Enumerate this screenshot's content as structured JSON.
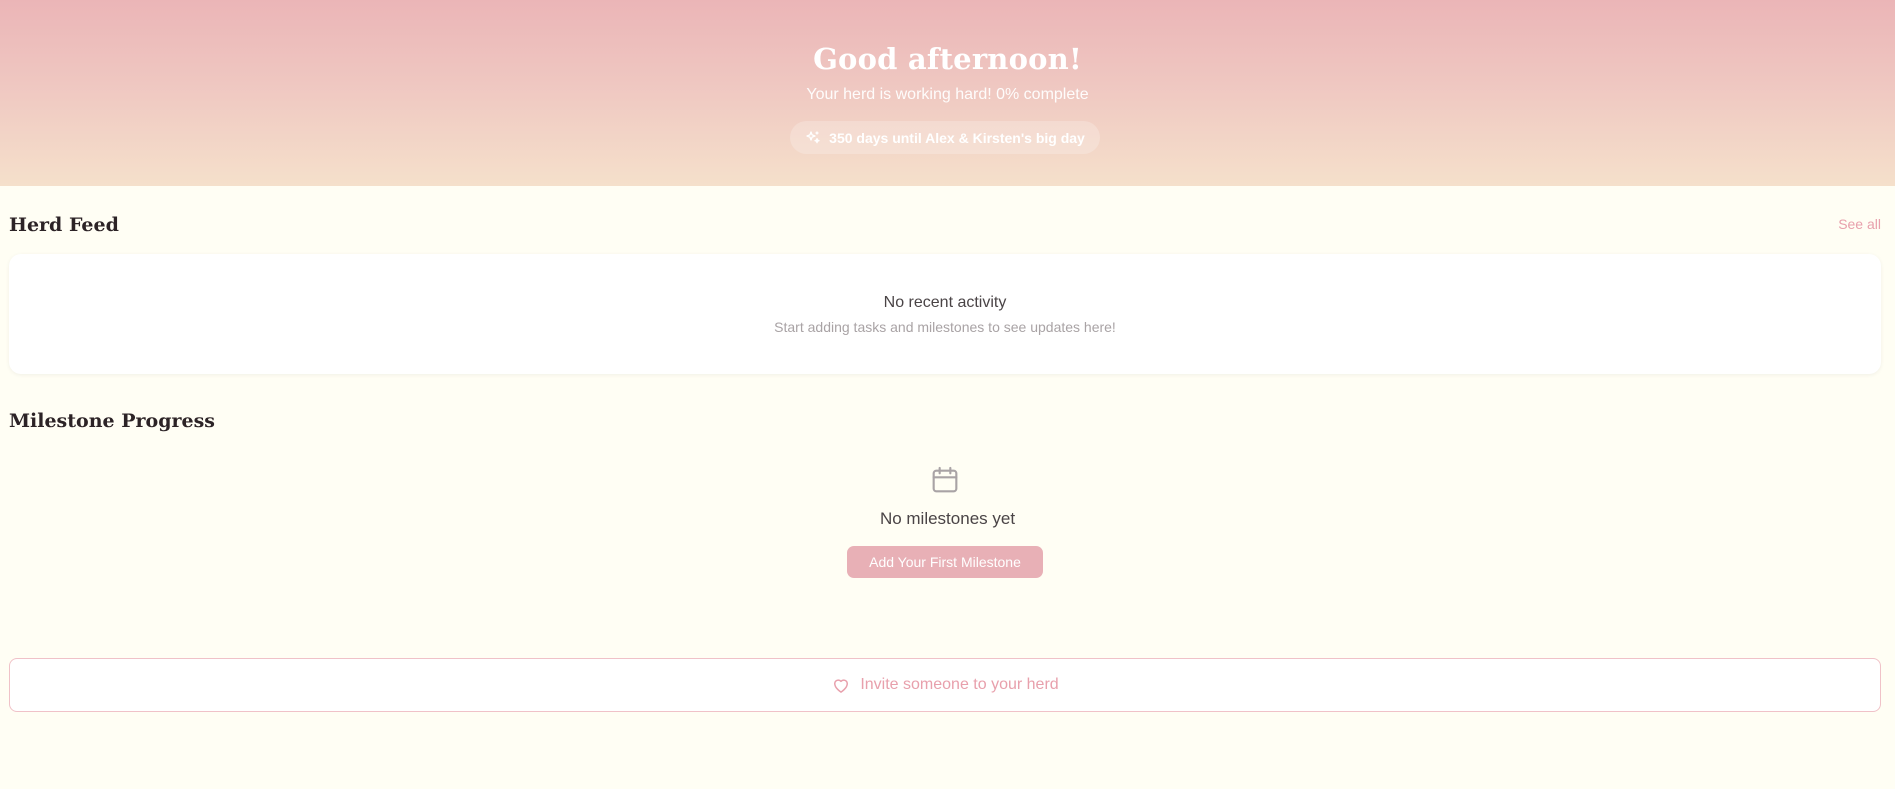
{
  "hero": {
    "greeting": "Good afternoon!",
    "subtitle": "Your herd is working hard! 0% complete",
    "countdown": "350 days until Alex & Kirsten's big day",
    "countdown_icon": "sparkles-icon",
    "gradient_top": "#ebb5b7",
    "gradient_bottom": "#f5e0cb"
  },
  "feed": {
    "title": "Herd Feed",
    "see_all": "See all",
    "empty_title": "No recent activity",
    "empty_subtitle": "Start adding tasks and milestones to see updates here!"
  },
  "milestones": {
    "title": "Milestone Progress",
    "empty_icon": "calendar-icon",
    "empty_title": "No milestones yet",
    "add_button": "Add Your First Milestone"
  },
  "invite": {
    "label": "Invite someone to your herd",
    "icon": "heart-icon"
  },
  "colors": {
    "background": "#fffef4",
    "accent": "#e8a0ac",
    "button": "#e8b0b6"
  }
}
